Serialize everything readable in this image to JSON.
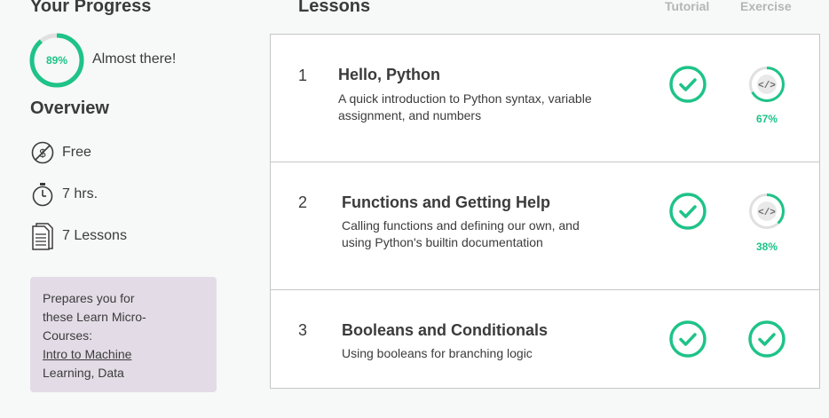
{
  "sidebar": {
    "progress_heading": "Your Progress",
    "progress": {
      "percent": 89,
      "label": "89%",
      "status": "Almost there!"
    },
    "overview_heading": "Overview",
    "overview_items": [
      {
        "icon": "no-cost-icon",
        "label": "Free"
      },
      {
        "icon": "stopwatch-icon",
        "label": "7 hrs."
      },
      {
        "icon": "document-icon",
        "label": "7 Lessons"
      }
    ],
    "prep": {
      "line1": "Prepares you for",
      "line2": "these Learn Micro-",
      "line3": "Courses:",
      "link_text": "Intro to Machine",
      "line5": "Learning, Data"
    }
  },
  "lessons": {
    "heading": "Lessons",
    "col_tutorial": "Tutorial",
    "col_exercise": "Exercise",
    "items": [
      {
        "num": "1",
        "title": "Hello, Python",
        "desc_line1": "A quick introduction to Python syntax, variable",
        "desc_line2": "assignment, and numbers",
        "tutorial": "complete",
        "exercise": "partial",
        "exercise_pct": 67,
        "exercise_pct_label": "67%"
      },
      {
        "num": "2",
        "title": "Functions and Getting Help",
        "desc_line1": "Calling functions and defining our own, and",
        "desc_line2": "using Python's builtin documentation",
        "tutorial": "complete",
        "exercise": "partial",
        "exercise_pct": 38,
        "exercise_pct_label": "38%"
      },
      {
        "num": "3",
        "title": "Booleans and Conditionals",
        "desc_line1": "Using booleans for branching logic",
        "desc_line2": "",
        "tutorial": "complete",
        "exercise": "complete"
      }
    ]
  },
  "colors": {
    "accent_green": "#20beff",
    "check_green": "#1ec388",
    "ring_track": "#e0e0e0",
    "prep_bg": "#e3dce7",
    "text_dark": "#3b3b3b",
    "header_muted": "#b5b5b5"
  }
}
